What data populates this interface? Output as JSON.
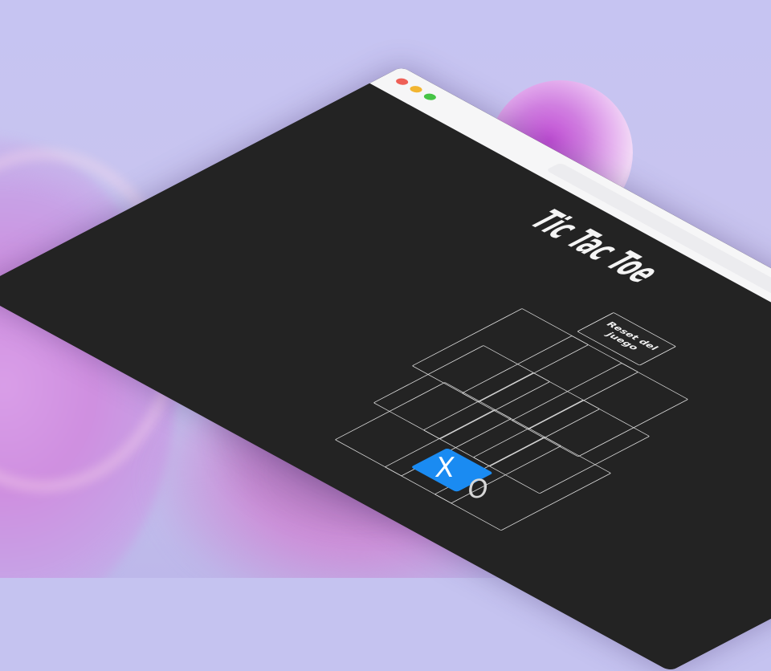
{
  "app": {
    "title": "Tic Tac Toe",
    "reset_label": "Reset del juego"
  },
  "board": {
    "cells": [
      "",
      "",
      "",
      "",
      "",
      "",
      "",
      "",
      ""
    ]
  },
  "turn": {
    "x_label": "X",
    "o_label": "O",
    "active": "X"
  },
  "colors": {
    "accent": "#1a8bf2",
    "content_bg": "#232323",
    "titlebar_bg": "#f6f6f7",
    "traffic_red": "#ee5f56",
    "traffic_yellow": "#f2b531",
    "traffic_green": "#46c446"
  }
}
